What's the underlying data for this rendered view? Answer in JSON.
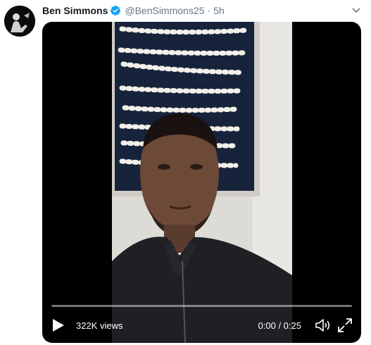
{
  "tweet": {
    "author_name": "Ben Simmons",
    "handle": "@BenSimmons25",
    "separator": "·",
    "time": "5h",
    "avatar_icon": "profile-photo",
    "verified_icon": "verified-badge-icon",
    "caret_icon": "chevron-down-icon"
  },
  "video": {
    "views": "322K views",
    "timecode": "0:00 / 0:25",
    "progress": 0,
    "play_icon": "play-icon",
    "volume_icon": "volume-icon",
    "fullscreen_icon": "fullscreen-icon"
  },
  "colors": {
    "verified": "#1da1f2",
    "meta_text": "#657786",
    "video_bg": "#000000"
  }
}
